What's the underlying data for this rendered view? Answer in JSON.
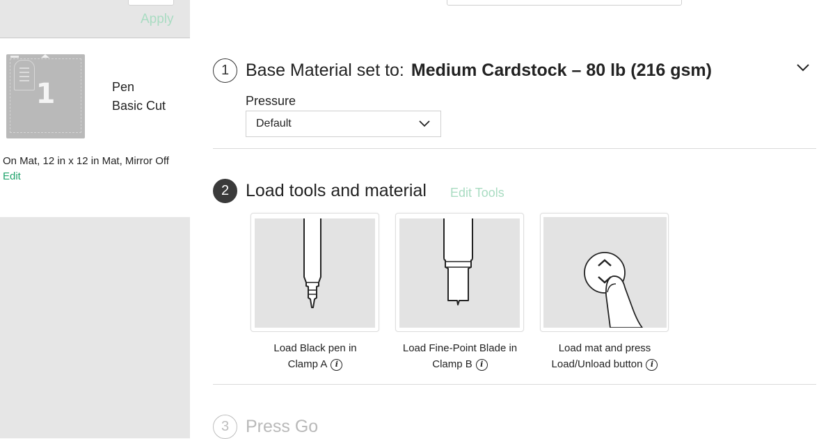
{
  "sidebar": {
    "apply_label": "Apply",
    "mat": {
      "number": "1",
      "tool": "Pen",
      "cut_type": "Basic Cut"
    },
    "mat_info": "On Mat, 12 in x 12 in Mat, Mirror Off",
    "edit_label": "Edit"
  },
  "step1": {
    "number": "1",
    "prefix": "Base Material set to:",
    "material": "Medium Cardstock – 80 lb (216 gsm)",
    "pressure_label": "Pressure",
    "pressure_value": "Default"
  },
  "step2": {
    "number": "2",
    "title": "Load tools and material",
    "edit_tools_label": "Edit Tools",
    "cards": [
      {
        "line1": "Load Black pen in",
        "line2": "Clamp A",
        "icon": "pen-icon"
      },
      {
        "line1": "Load Fine-Point Blade in",
        "line2": "Clamp B",
        "icon": "blade-icon"
      },
      {
        "line1": "Load mat and press",
        "line2": "Load/Unload button",
        "icon": "load-unload-button-icon"
      }
    ]
  },
  "step3": {
    "number": "3",
    "title": "Press Go"
  },
  "colors": {
    "accent_green": "#1fa36b",
    "muted_green": "#a9dcc2",
    "panel_gray": "#e6e6e6",
    "disabled_gray": "#b9b9b9"
  }
}
